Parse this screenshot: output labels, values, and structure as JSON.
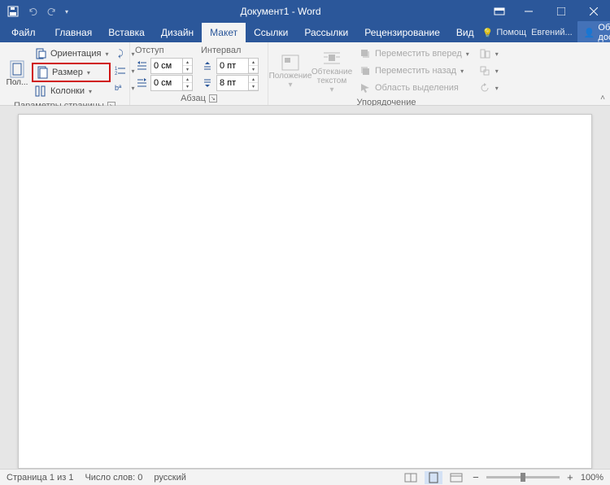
{
  "titlebar": {
    "title": "Документ1 - Word"
  },
  "tabs": {
    "file": "Файл",
    "items": [
      "Главная",
      "Вставка",
      "Дизайн",
      "Макет",
      "Ссылки",
      "Рассылки",
      "Рецензирование",
      "Вид"
    ],
    "active_index": 3,
    "tell_me": "Помощ",
    "user": "Евгений...",
    "share": "Общий доступ"
  },
  "ribbon": {
    "page_setup": {
      "margins": "Пол...",
      "orientation": "Ориентация",
      "size": "Размер",
      "columns": "Колонки",
      "label": "Параметры страницы"
    },
    "paragraph": {
      "indent_header": "Отступ",
      "spacing_header": "Интервал",
      "indent_left": "0 см",
      "indent_right": "0 см",
      "space_before": "0 пт",
      "space_after": "8 пт",
      "label": "Абзац"
    },
    "arrange": {
      "position": "Положение",
      "wrap": "Обтекание\nтекстом",
      "bring_forward": "Переместить вперед",
      "send_backward": "Переместить назад",
      "selection_pane": "Область выделения",
      "label": "Упорядочение"
    }
  },
  "statusbar": {
    "page": "Страница 1 из 1",
    "words": "Число слов: 0",
    "language": "русский",
    "zoom": "100%"
  }
}
